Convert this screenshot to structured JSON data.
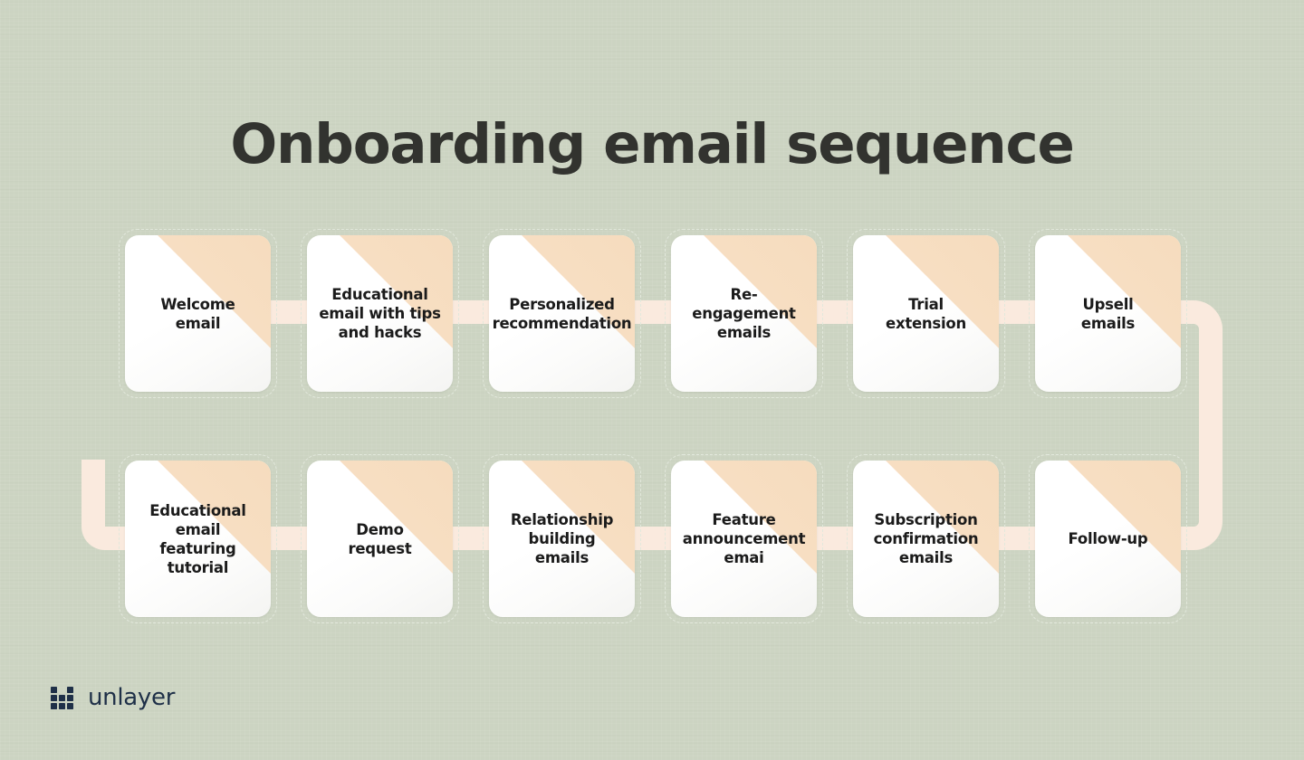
{
  "meta": {
    "background_color": "#ccd4c2",
    "title_color": "#32332f",
    "card_color": "#ffffff",
    "card_corner_accent": "#f7dec2",
    "connector_color": "#faeade",
    "card_outline_color": "#e2e8dc",
    "logo_color": "#1f3048"
  },
  "header": {
    "title": "Onboarding email sequence"
  },
  "flow": {
    "rows": [
      {
        "row_index": 1,
        "cards": [
          {
            "label": "Welcome\nemail"
          },
          {
            "label": "Educational\nemail with tips\nand hacks"
          },
          {
            "label": "Personalized\nrecommendation"
          },
          {
            "label": "Re-engagement\nemails"
          },
          {
            "label": "Trial\nextension"
          },
          {
            "label": "Upsell\nemails"
          }
        ]
      },
      {
        "row_index": 2,
        "cards": [
          {
            "label": "Educational\nemail featuring\ntutorial"
          },
          {
            "label": "Demo\nrequest"
          },
          {
            "label": "Relationship\nbuilding\nemails"
          },
          {
            "label": "Feature\nannouncement\nemai"
          },
          {
            "label": "Subscription\nconfirmation\nemails"
          },
          {
            "label": "Follow-up"
          }
        ]
      }
    ]
  },
  "footer": {
    "logo_text": "unlayer",
    "logo_icon": "unlayer-blocks-icon"
  }
}
